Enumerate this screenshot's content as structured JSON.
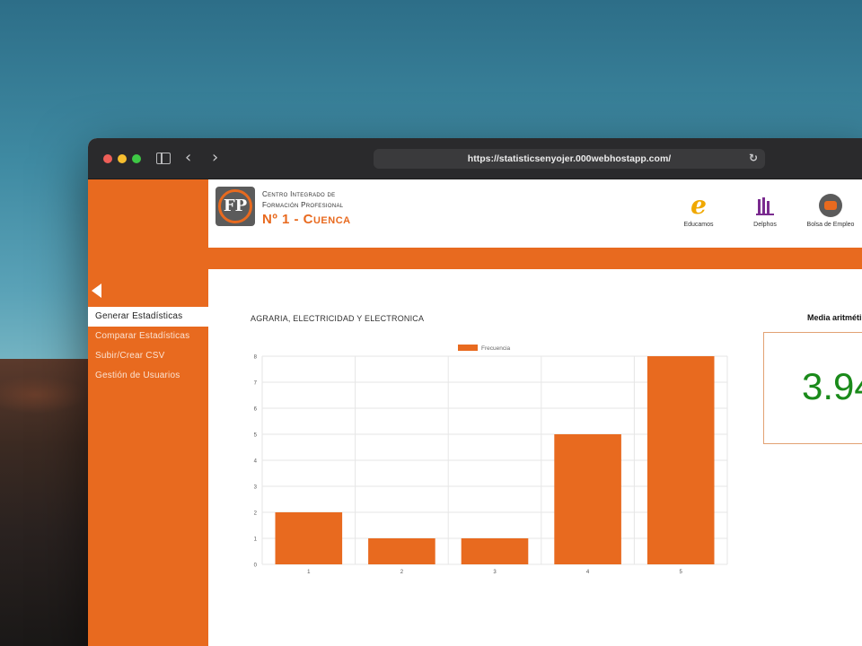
{
  "browser": {
    "url": "https://statisticsenyojer.000webhostapp.com/"
  },
  "header": {
    "org_line1": "Centro Integrado de",
    "org_line2": "Formación Profesional",
    "org_line3": "Nº 1 - Cuenca",
    "logo_text": "FP",
    "links": [
      {
        "label": "Educamos",
        "icon": "educamos-icon"
      },
      {
        "label": "Delphos",
        "icon": "delphos-icon"
      },
      {
        "label": "Bolsa de Empleo",
        "icon": "bolsa-empleo-icon"
      }
    ]
  },
  "sidebar": {
    "items": [
      {
        "label": "Generar Estadísticas",
        "active": true
      },
      {
        "label": "Comparar Estadísticas",
        "active": false
      },
      {
        "label": "Subir/Crear CSV",
        "active": false
      },
      {
        "label": "Gestión de Usuarios",
        "active": false
      }
    ]
  },
  "main": {
    "chart_title": "AGRARIA, ELECTRICIDAD Y ELECTRONICA",
    "stat_title": "Media aritméti",
    "stat_value": "3.94"
  },
  "colors": {
    "accent": "#e86a1f",
    "stat_value": "#1a8a1a"
  },
  "chart_data": {
    "type": "bar",
    "categories": [
      "1",
      "2",
      "3",
      "4",
      "5"
    ],
    "series": [
      {
        "name": "Frecuencia",
        "values": [
          2,
          1,
          1,
          5,
          8
        ],
        "color": "#e86a1f"
      }
    ],
    "ylim": [
      0,
      8
    ],
    "yticks": [
      0,
      1,
      2,
      3,
      4,
      5,
      6,
      7,
      8
    ],
    "grid": true,
    "legend": "top-center"
  }
}
